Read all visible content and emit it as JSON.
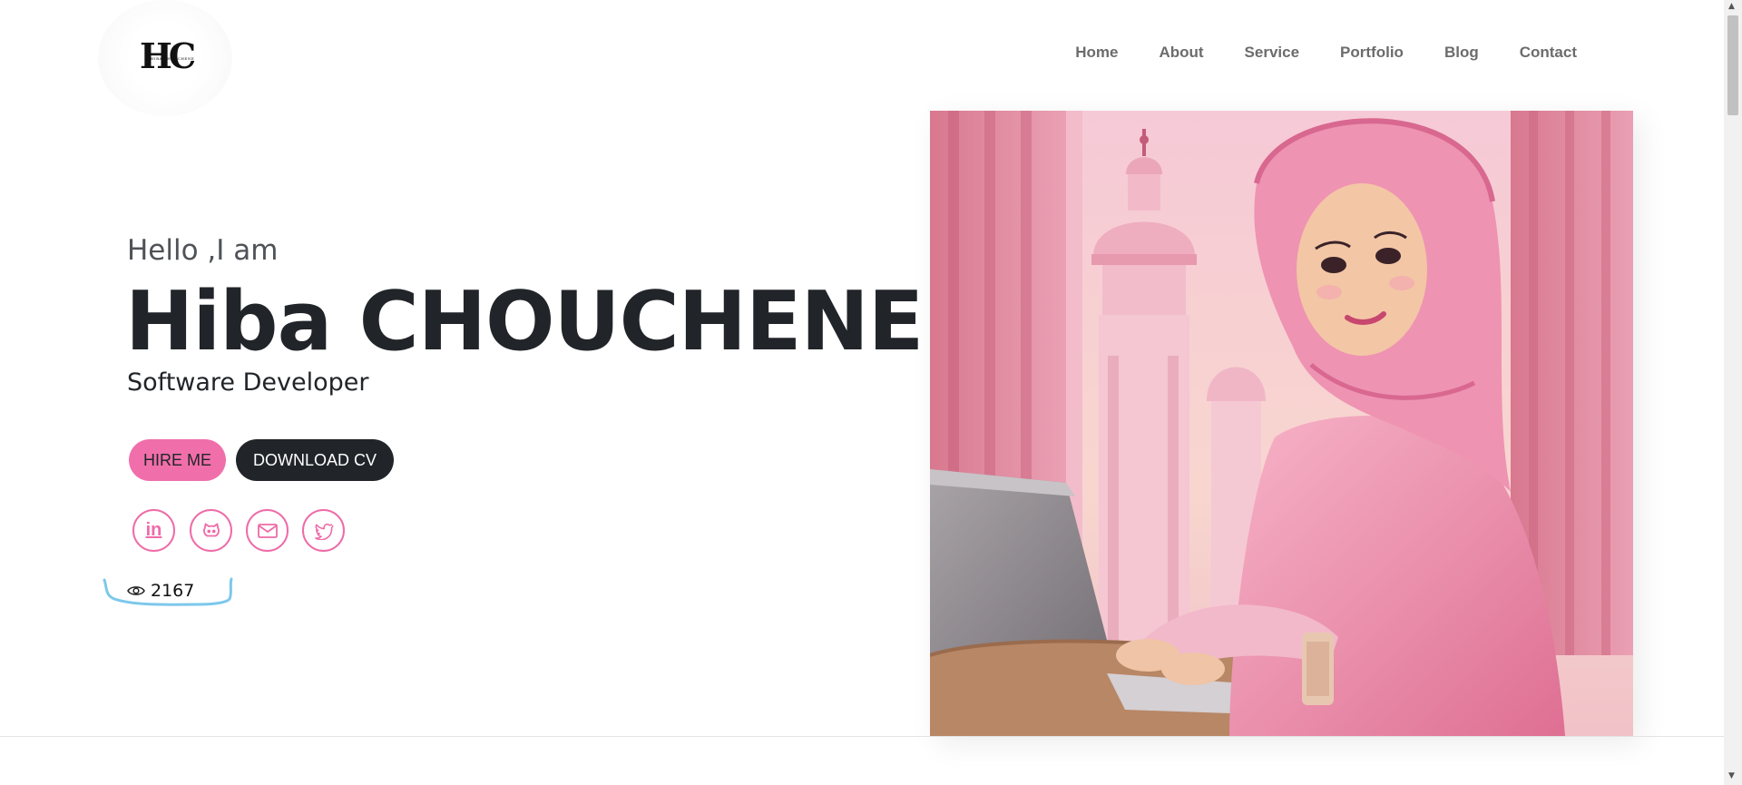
{
  "header": {
    "logo_monogram": "HC",
    "logo_subtext": "HIBA CHOUCHENE",
    "nav": [
      "Home",
      "About",
      "Service",
      "Portfolio",
      "Blog",
      "Contact"
    ]
  },
  "hero": {
    "greeting": "Hello ,I am",
    "name": "Hiba CHOUCHENE",
    "role": "Software Developer",
    "hire_label": "HIRE ME",
    "cv_label": "DOWNLOAD CV",
    "social": [
      "linkedin-icon",
      "github-icon",
      "mail-icon",
      "twitter-icon"
    ],
    "views": "2167"
  },
  "colors": {
    "accent_pink": "#f06fab",
    "dark": "#212529",
    "highlight_scribble": "#7cc8ea"
  }
}
